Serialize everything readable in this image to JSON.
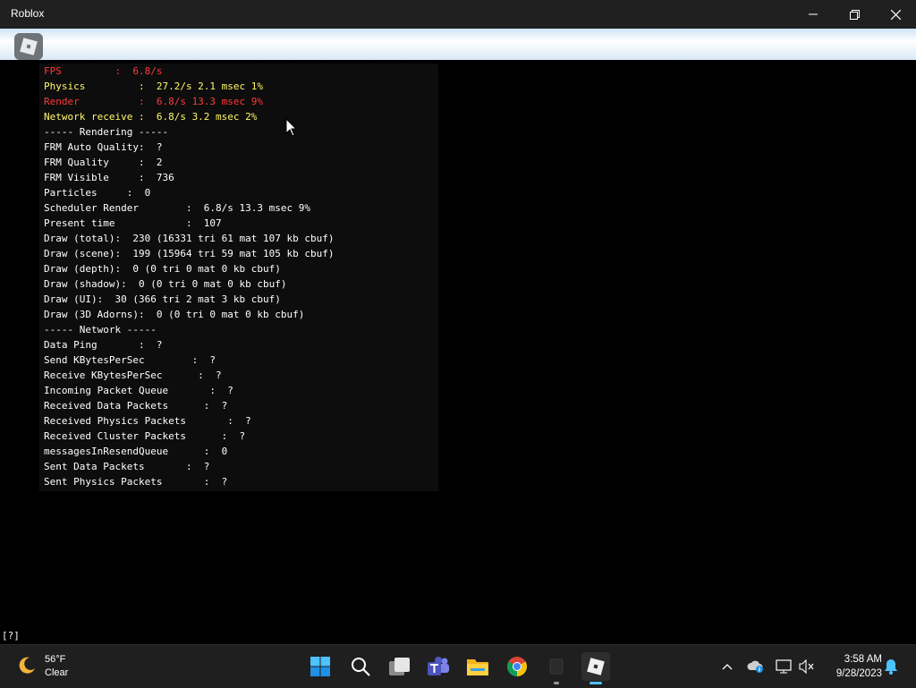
{
  "window": {
    "title": "Roblox"
  },
  "stats": [
    {
      "text": "FPS         :  6.8/s",
      "color": "red"
    },
    {
      "text": "Physics         :  27.2/s 2.1 msec 1%",
      "color": "yellow"
    },
    {
      "text": "Render          :  6.8/s 13.3 msec 9%",
      "color": "red"
    },
    {
      "text": "Network receive :  6.8/s 3.2 msec 2%",
      "color": "yellow"
    },
    {
      "text": "----- Rendering -----",
      "color": "white"
    },
    {
      "text": "FRM Auto Quality:  ?",
      "color": "white"
    },
    {
      "text": "FRM Quality     :  2",
      "color": "white"
    },
    {
      "text": "FRM Visible     :  736",
      "color": "white"
    },
    {
      "text": "Particles     :  0",
      "color": "white"
    },
    {
      "text": "Scheduler Render        :  6.8/s 13.3 msec 9%",
      "color": "white"
    },
    {
      "text": "Present time            :  107",
      "color": "white"
    },
    {
      "text": "Draw (total):  230 (16331 tri 61 mat 107 kb cbuf)",
      "color": "white"
    },
    {
      "text": "Draw (scene):  199 (15964 tri 59 mat 105 kb cbuf)",
      "color": "white"
    },
    {
      "text": "Draw (depth):  0 (0 tri 0 mat 0 kb cbuf)",
      "color": "white"
    },
    {
      "text": "Draw (shadow):  0 (0 tri 0 mat 0 kb cbuf)",
      "color": "white"
    },
    {
      "text": "Draw (UI):  30 (366 tri 2 mat 3 kb cbuf)",
      "color": "white"
    },
    {
      "text": "Draw (3D Adorns):  0 (0 tri 0 mat 0 kb cbuf)",
      "color": "white"
    },
    {
      "text": "----- Network -----",
      "color": "white"
    },
    {
      "text": "Data Ping       :  ?",
      "color": "white"
    },
    {
      "text": "Send KBytesPerSec        :  ?",
      "color": "white"
    },
    {
      "text": "Receive KBytesPerSec      :  ?",
      "color": "white"
    },
    {
      "text": "Incoming Packet Queue       :  ?",
      "color": "white"
    },
    {
      "text": "Received Data Packets      :  ?",
      "color": "white"
    },
    {
      "text": "Received Physics Packets       :  ?",
      "color": "white"
    },
    {
      "text": "Received Cluster Packets      :  ?",
      "color": "white"
    },
    {
      "text": "messagesInResendQueue      :  0",
      "color": "white"
    },
    {
      "text": "Sent Data Packets       :  ?",
      "color": "white"
    },
    {
      "text": "Sent Physics Packets       :  ?",
      "color": "white"
    }
  ],
  "bottom_text": "[?]",
  "weather": {
    "temp": "56°F",
    "condition": "Clear"
  },
  "clock": {
    "time": "3:58 AM",
    "date": "9/28/2023"
  },
  "colors": {
    "red": "#ff3a3a",
    "yellow": "#fff96a",
    "white": "#ffffff"
  },
  "taskbar_icons": [
    "start-icon",
    "search-icon",
    "task-view-icon",
    "teams-icon",
    "file-explorer-icon",
    "chrome-icon",
    "app-icon",
    "roblox-icon"
  ]
}
